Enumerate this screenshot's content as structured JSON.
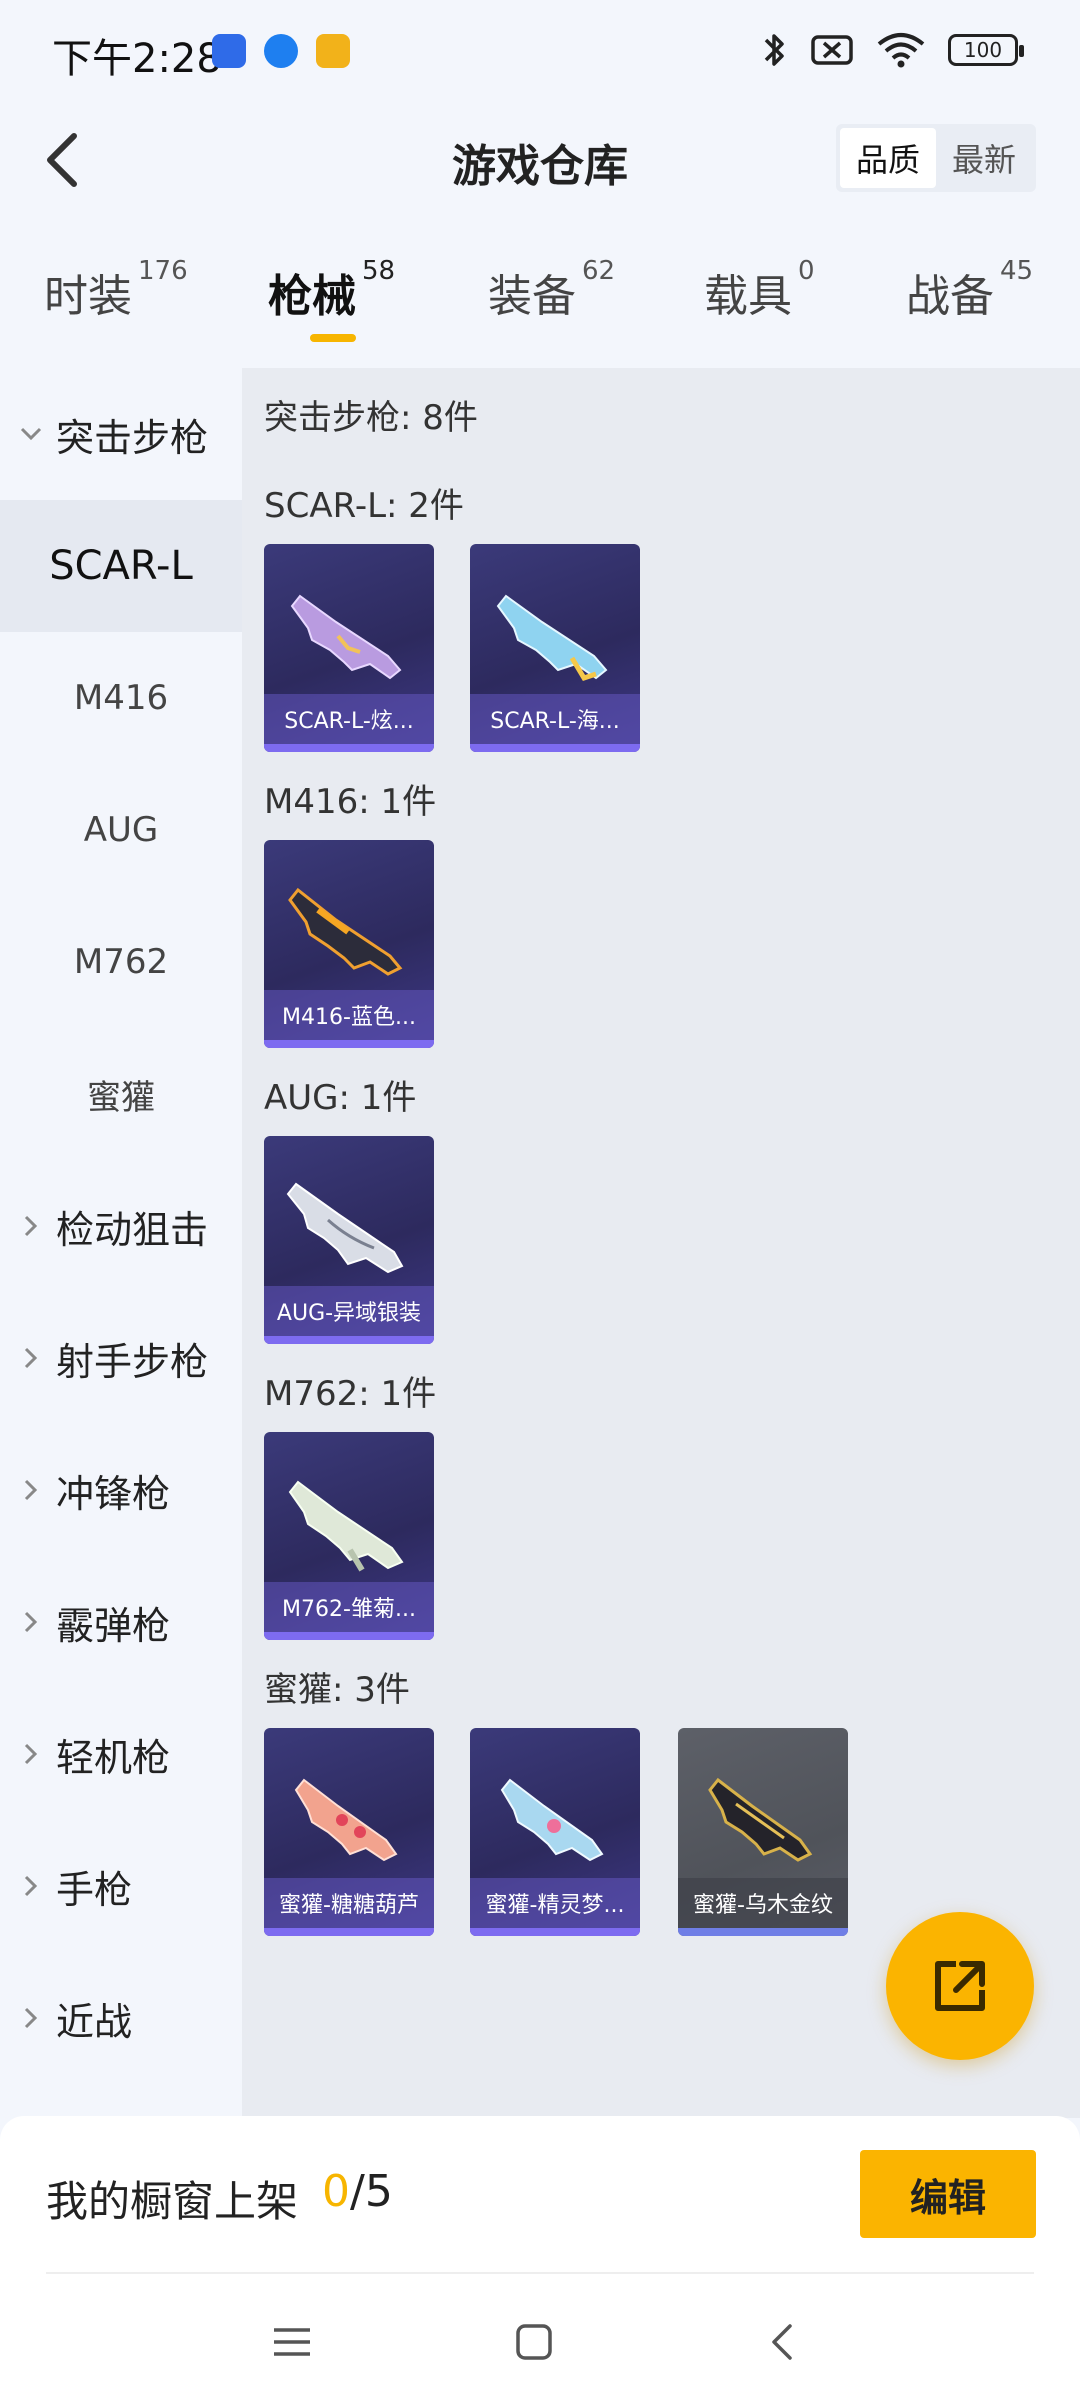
{
  "status_bar": {
    "time": "下午2:28",
    "battery": "100",
    "icons": [
      "baidu-app-icon",
      "browser-app-icon",
      "game-app-icon",
      "bluetooth-icon",
      "sim-off-icon",
      "wifi-icon",
      "battery-icon"
    ]
  },
  "header": {
    "title": "游戏仓库",
    "sort_options": [
      "品质",
      "最新"
    ],
    "sort_active": "品质"
  },
  "tabs": [
    {
      "label": "时装",
      "count": "176"
    },
    {
      "label": "枪械",
      "count": "58",
      "active": true
    },
    {
      "label": "装备",
      "count": "62"
    },
    {
      "label": "载具",
      "count": "0"
    },
    {
      "label": "战备",
      "count": "45"
    }
  ],
  "sidebar": {
    "expanded_category": "突击步枪",
    "sub_items": [
      "SCAR-L",
      "M416",
      "AUG",
      "M762",
      "蜜獾"
    ],
    "active_sub_item": "SCAR-L",
    "categories": [
      "检动狙击",
      "射手步枪",
      "冲锋枪",
      "霰弹枪",
      "轻机枪",
      "手枪",
      "近战"
    ]
  },
  "content": {
    "category_summary": "突击步枪: 8件",
    "groups": [
      {
        "title": "SCAR-L: 2件",
        "items": [
          "SCAR-L-炫...",
          "SCAR-L-海..."
        ]
      },
      {
        "title": "M416: 1件",
        "items": [
          "M416-蓝色..."
        ]
      },
      {
        "title": "AUG: 1件",
        "items": [
          "AUG-异域银装"
        ]
      },
      {
        "title": "M762: 1件",
        "items": [
          "M762-雏菊..."
        ]
      },
      {
        "title": "蜜獾: 3件",
        "items": [
          "蜜獾-糖糖葫芦",
          "蜜獾-精灵梦...",
          "蜜獾-乌木金纹"
        ]
      }
    ]
  },
  "bottom_bar": {
    "showcase_label": "我的橱窗上架",
    "showcase_current": "0",
    "showcase_separator": "/",
    "showcase_max": "5",
    "edit_label": "编辑"
  },
  "colors": {
    "accent": "#fbb400",
    "card_bg": "#2d2a5e",
    "card_label": "#6256be"
  }
}
